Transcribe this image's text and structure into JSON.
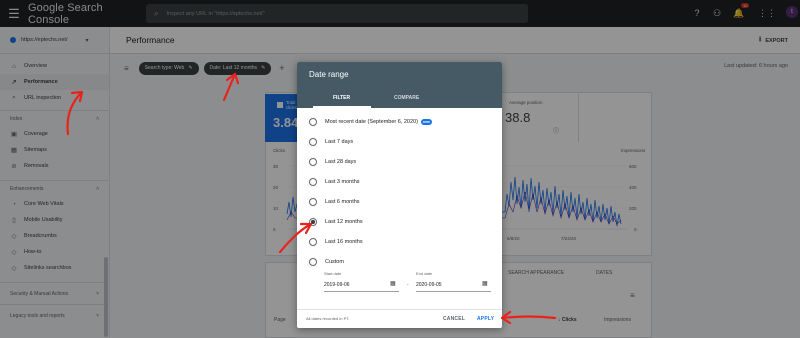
{
  "topbar": {
    "brand": "Google Search Console",
    "search_placeholder": "Inspect any URL in \"https://eptechs.net/\"",
    "notification_count": "10",
    "avatar_letter": "t"
  },
  "sidebar": {
    "property": "https://eptechs.net/",
    "items": [
      {
        "label": "Overview",
        "icon": "home-icon"
      },
      {
        "label": "Performance",
        "icon": "trending-up-icon"
      },
      {
        "label": "URL inspection",
        "icon": "search-icon"
      }
    ],
    "index": {
      "label": "Index",
      "items": [
        {
          "label": "Coverage"
        },
        {
          "label": "Sitemaps"
        },
        {
          "label": "Removals"
        }
      ]
    },
    "enhancements": {
      "label": "Enhancements",
      "items": [
        {
          "label": "Core Web Vitals"
        },
        {
          "label": "Mobile Usability"
        },
        {
          "label": "Breadcrumbs"
        },
        {
          "label": "How-to"
        },
        {
          "label": "Sitelinks searchbox"
        }
      ]
    },
    "security": "Security & Manual Actions",
    "legacy": "Legacy tools and reports"
  },
  "main": {
    "title": "Performance",
    "export_label": "EXPORT",
    "chips": [
      {
        "label": "Search type: Web"
      },
      {
        "label": "Date: Last 12 months"
      }
    ],
    "last_updated": "Last updated: 6 hours ago",
    "metric_clicks": {
      "label": "Total clicks",
      "value": "3.84"
    },
    "metric_position": {
      "label": "Average position",
      "value": "38.8"
    },
    "chart": {
      "left_axis_title": "Clicks",
      "left_ticks": [
        "30",
        "20",
        "10",
        "0"
      ],
      "right_axis_title": "Impressions",
      "right_ticks": [
        "600",
        "400",
        "200",
        "0"
      ],
      "x_ticks": [
        "6/8/20",
        "7/24/20"
      ]
    },
    "table": {
      "tabs": [
        "SEARCH APPEARANCE",
        "DATES"
      ],
      "col_page": "Page",
      "col_clicks": "Clicks",
      "col_impressions": "Impressions"
    }
  },
  "dialog": {
    "title": "Date range",
    "tabs": {
      "filter": "FILTER",
      "compare": "COMPARE"
    },
    "options": [
      {
        "label": "Most recent date (September 6, 2020)",
        "new": "new"
      },
      {
        "label": "Last 7 days"
      },
      {
        "label": "Last 28 days"
      },
      {
        "label": "Last 3 months"
      },
      {
        "label": "Last 6 months"
      },
      {
        "label": "Last 12 months"
      },
      {
        "label": "Last 16 months"
      },
      {
        "label": "Custom"
      }
    ],
    "selected_index": 5,
    "start_label": "Start date",
    "start_value": "2019-09-06",
    "end_label": "End date",
    "end_value": "2020-09-05",
    "footer_note": "All dates recorded in PT.",
    "cancel": "CANCEL",
    "apply": "APPLY"
  },
  "colors": {
    "topbar": "#202124",
    "dialog_header": "#455a64",
    "accent_blue": "#1a73e8",
    "accent_purple": "#5e35b1",
    "annotation_red": "#e8231b"
  }
}
